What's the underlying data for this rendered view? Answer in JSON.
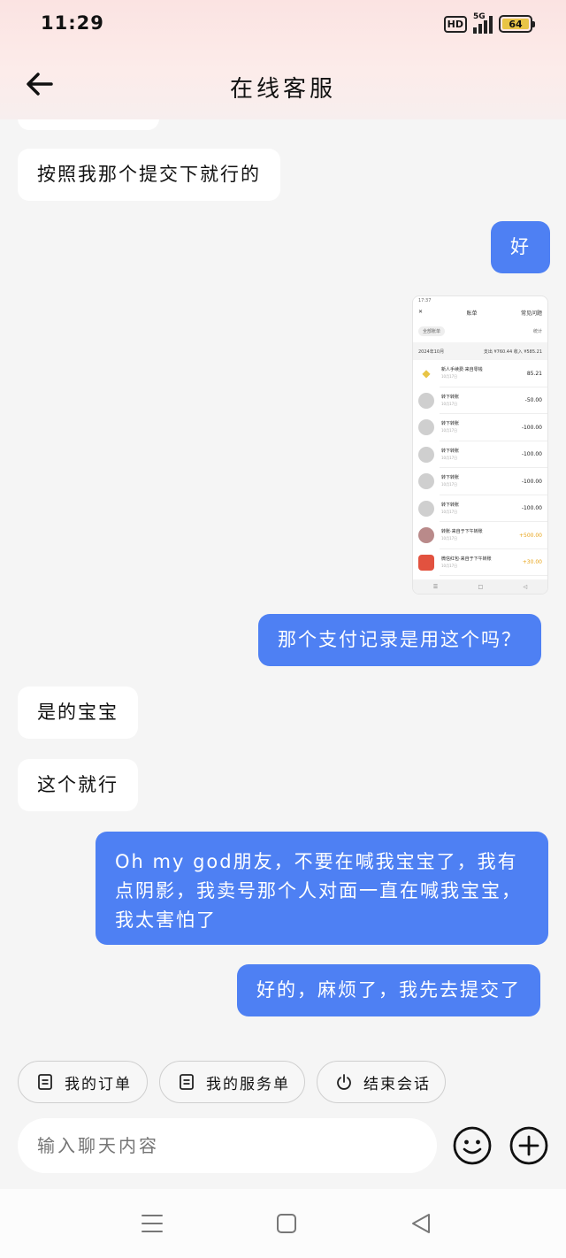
{
  "status": {
    "time": "11:29",
    "hd": "HD",
    "network": "5G",
    "battery": "64"
  },
  "header": {
    "title": "在线客服",
    "back_icon": "arrow-left-icon"
  },
  "messages": [
    {
      "side": "left",
      "text": "按照我那个提交下就行的"
    },
    {
      "side": "right",
      "text": "好"
    },
    {
      "side": "right",
      "text": "那个支付记录是用这个吗？"
    },
    {
      "side": "left",
      "text": "是的宝宝"
    },
    {
      "side": "left",
      "text": "这个就行"
    },
    {
      "side": "right",
      "text": "Oh my god朋友，不要在喊我宝宝了，我有点阴影，我卖号那个人对面一直在喊我宝宝，我太害怕了"
    },
    {
      "side": "right",
      "text": "好的，麻烦了，我先去提交了"
    }
  ],
  "screenshot": {
    "status": "17:37",
    "nav_title": "账单",
    "nav_right": "常见问题",
    "filter": "全部账单",
    "filter_right": "统计",
    "month": "2024年10月",
    "month_right": "支出 ¥760.44  收入 ¥585.21",
    "rows": [
      {
        "name": "新人手续费·来自零钱",
        "time": "10月17日",
        "amount": "85.21",
        "gold": false
      },
      {
        "name": "转下转账",
        "time": "10月17日",
        "amount": "-50.00",
        "gold": false
      },
      {
        "name": "转下转账",
        "time": "10月17日",
        "amount": "-100.00",
        "gold": false
      },
      {
        "name": "转下转账",
        "time": "10月17日",
        "amount": "-100.00",
        "gold": false
      },
      {
        "name": "转下转账",
        "time": "10月17日",
        "amount": "-100.00",
        "gold": false
      },
      {
        "name": "转下转账",
        "time": "10月17日",
        "amount": "-100.00",
        "gold": false
      },
      {
        "name": "转账·来自于下午转账",
        "time": "10月17日",
        "amount": "+500.00",
        "gold": true
      },
      {
        "name": "微信红包·来自于下午转账",
        "time": "10月17日",
        "amount": "+30.00",
        "gold": true
      }
    ]
  },
  "quick_actions": [
    {
      "label": "我的订单",
      "icon": "document-icon"
    },
    {
      "label": "我的服务单",
      "icon": "document-icon"
    },
    {
      "label": "结束会话",
      "icon": "power-icon"
    }
  ],
  "input": {
    "placeholder": "输入聊天内容"
  },
  "colors": {
    "accent": "#4e80f3",
    "bubble_left": "#ffffff",
    "background": "#f5f5f5"
  }
}
